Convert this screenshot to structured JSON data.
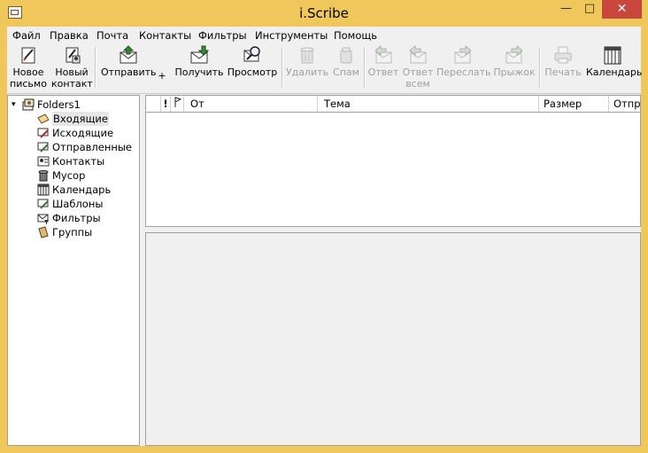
{
  "window": {
    "title": "i.Scribe"
  },
  "menu": [
    "Файл",
    "Правка",
    "Почта",
    "Контакты",
    "Фильтры",
    "Инструменты",
    "Помощь"
  ],
  "toolbar": {
    "new_mail": [
      "Новое",
      "письмо"
    ],
    "new_contact": [
      "Новый",
      "контакт"
    ],
    "send": "Отправить",
    "plus": "+",
    "receive": "Получить",
    "preview": "Просмотр",
    "delete": "Удалить",
    "spam": "Спам",
    "reply": "Ответ",
    "reply_all": [
      "Ответ",
      "всем"
    ],
    "forward": "Переслать",
    "bounce": "Прыжок",
    "print": "Печать",
    "calendar": "Календарь"
  },
  "folders": {
    "root": "Folders1",
    "items": [
      {
        "label": "Входящие",
        "icon": "inbox-icon",
        "selected": true
      },
      {
        "label": "Исходящие",
        "icon": "outbox-icon"
      },
      {
        "label": "Отправленные",
        "icon": "sent-icon"
      },
      {
        "label": "Контакты",
        "icon": "contacts-icon"
      },
      {
        "label": "Мусор",
        "icon": "trash-icon"
      },
      {
        "label": "Календарь",
        "icon": "calendar-icon"
      },
      {
        "label": "Шаблоны",
        "icon": "templates-icon"
      },
      {
        "label": "Фильтры",
        "icon": "filters-icon"
      },
      {
        "label": "Группы",
        "icon": "groups-icon"
      }
    ]
  },
  "columns": {
    "priority": "!",
    "flag": "",
    "from": "От",
    "subject": "Тема",
    "size": "Размер",
    "sent": "Отпр"
  }
}
